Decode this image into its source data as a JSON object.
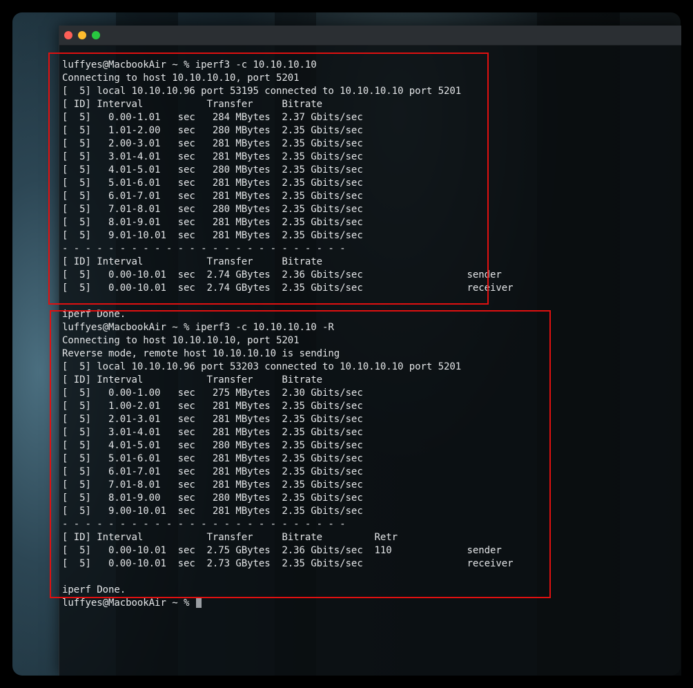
{
  "window": {
    "title": ""
  },
  "colors": {
    "highlight": "#e01010",
    "text": "#e4e6e8",
    "close": "#fe5f57",
    "minimize": "#febc2e",
    "zoom": "#28c840"
  },
  "terminal": {
    "lines": [
      "luffyes@MacbookAir ~ % iperf3 -c 10.10.10.10",
      "Connecting to host 10.10.10.10, port 5201",
      "[  5] local 10.10.10.96 port 53195 connected to 10.10.10.10 port 5201",
      "[ ID] Interval           Transfer     Bitrate",
      "[  5]   0.00-1.01   sec   284 MBytes  2.37 Gbits/sec",
      "[  5]   1.01-2.00   sec   280 MBytes  2.35 Gbits/sec",
      "[  5]   2.00-3.01   sec   281 MBytes  2.35 Gbits/sec",
      "[  5]   3.01-4.01   sec   281 MBytes  2.35 Gbits/sec",
      "[  5]   4.01-5.01   sec   280 MBytes  2.35 Gbits/sec",
      "[  5]   5.01-6.01   sec   281 MBytes  2.35 Gbits/sec",
      "[  5]   6.01-7.01   sec   281 MBytes  2.35 Gbits/sec",
      "[  5]   7.01-8.01   sec   280 MBytes  2.35 Gbits/sec",
      "[  5]   8.01-9.01   sec   281 MBytes  2.35 Gbits/sec",
      "[  5]   9.01-10.01  sec   281 MBytes  2.35 Gbits/sec",
      "- - - - - - - - - - - - - - - - - - - - - - - - -",
      "[ ID] Interval           Transfer     Bitrate",
      "[  5]   0.00-10.01  sec  2.74 GBytes  2.36 Gbits/sec                  sender",
      "[  5]   0.00-10.01  sec  2.74 GBytes  2.35 Gbits/sec                  receiver",
      "",
      "iperf Done.",
      "luffyes@MacbookAir ~ % iperf3 -c 10.10.10.10 -R",
      "Connecting to host 10.10.10.10, port 5201",
      "Reverse mode, remote host 10.10.10.10 is sending",
      "[  5] local 10.10.10.96 port 53203 connected to 10.10.10.10 port 5201",
      "[ ID] Interval           Transfer     Bitrate",
      "[  5]   0.00-1.00   sec   275 MBytes  2.30 Gbits/sec",
      "[  5]   1.00-2.01   sec   281 MBytes  2.35 Gbits/sec",
      "[  5]   2.01-3.01   sec   281 MBytes  2.35 Gbits/sec",
      "[  5]   3.01-4.01   sec   281 MBytes  2.35 Gbits/sec",
      "[  5]   4.01-5.01   sec   280 MBytes  2.35 Gbits/sec",
      "[  5]   5.01-6.01   sec   281 MBytes  2.35 Gbits/sec",
      "[  5]   6.01-7.01   sec   281 MBytes  2.35 Gbits/sec",
      "[  5]   7.01-8.01   sec   281 MBytes  2.35 Gbits/sec",
      "[  5]   8.01-9.00   sec   280 MBytes  2.35 Gbits/sec",
      "[  5]   9.00-10.01  sec   281 MBytes  2.35 Gbits/sec",
      "- - - - - - - - - - - - - - - - - - - - - - - - -",
      "[ ID] Interval           Transfer     Bitrate         Retr",
      "[  5]   0.00-10.01  sec  2.75 GBytes  2.36 Gbits/sec  110             sender",
      "[  5]   0.00-10.01  sec  2.73 GBytes  2.35 Gbits/sec                  receiver",
      "",
      "iperf Done."
    ],
    "prompt": "luffyes@MacbookAir ~ % "
  }
}
